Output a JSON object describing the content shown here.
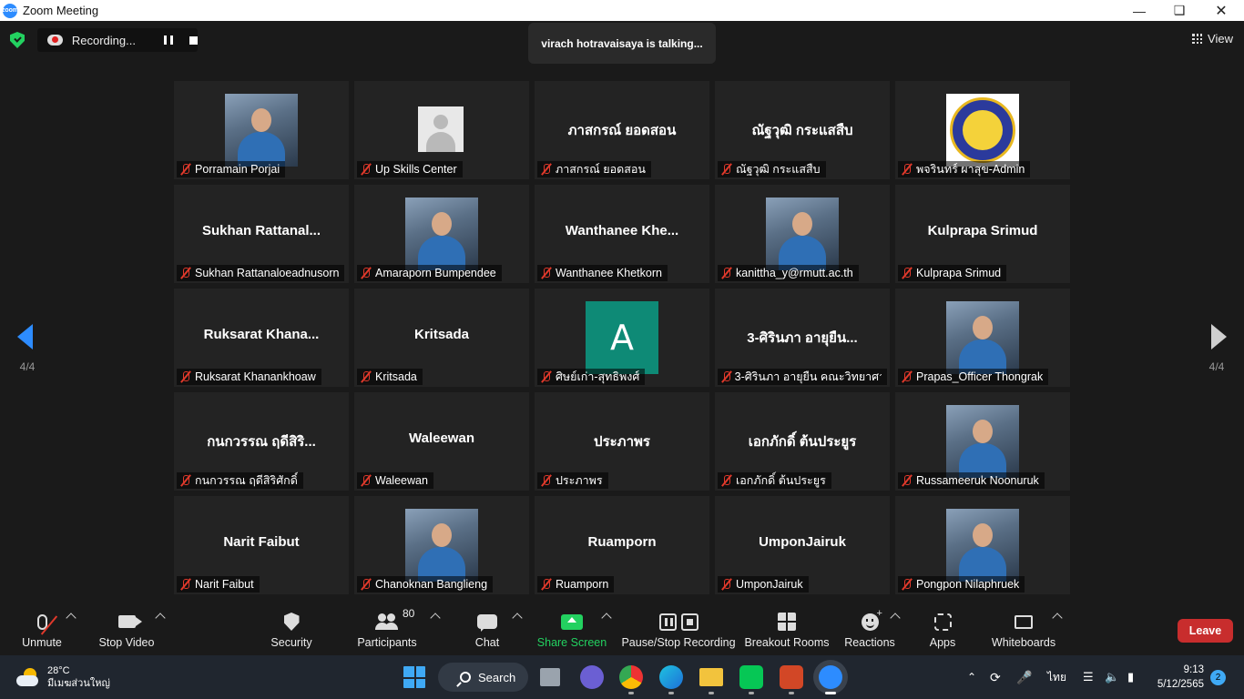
{
  "window": {
    "title": "Zoom Meeting",
    "icon": "zoom-icon"
  },
  "recording": {
    "label": "Recording..."
  },
  "talking_banner": "virach hotravaisaya is talking...",
  "view_button": "View",
  "page_indicator": {
    "left": "4/4",
    "right": "4/4"
  },
  "participants": [
    {
      "name": "Porramain Porjai",
      "display": "",
      "avatar": "photo"
    },
    {
      "name": "Up Skills Center",
      "display": "",
      "avatar": "generic"
    },
    {
      "name": "ภาสกรณ์ ยอดสอน",
      "display": "ภาสกรณ์ ยอดสอน",
      "avatar": "none"
    },
    {
      "name": "ณัฐวุฒิ กระแสสืบ",
      "display": "ณัฐวุฒิ กระแสสืบ",
      "avatar": "none"
    },
    {
      "name": "พจรินทร์ ผาสุข-Admin",
      "display": "",
      "avatar": "logo"
    },
    {
      "name": "Sukhan Rattanaloeadnusorn",
      "display": "Sukhan  Rattanal...",
      "avatar": "none"
    },
    {
      "name": "Amaraporn Bumpendee",
      "display": "",
      "avatar": "photo"
    },
    {
      "name": "Wanthanee Khetkorn",
      "display": "Wanthanee  Khe...",
      "avatar": "none"
    },
    {
      "name": "kanittha_y@rmutt.ac.th",
      "display": "",
      "avatar": "photo"
    },
    {
      "name": "Kulprapa Srimud",
      "display": "Kulprapa Srimud",
      "avatar": "none"
    },
    {
      "name": "Ruksarat Khanankhoaw",
      "display": "Ruksarat  Khana...",
      "avatar": "none"
    },
    {
      "name": "Kritsada",
      "display": "Kritsada",
      "avatar": "none"
    },
    {
      "name": "ศิษย์เก่า-สุทธิพงศ์",
      "display": "",
      "avatar": "letter",
      "letter": "A"
    },
    {
      "name": "3-ศิรินภา อายุยืน คณะวิทยาศา...",
      "display": "3-ศิรินภา อายุยืน...",
      "avatar": "none"
    },
    {
      "name": "Prapas_Officer Thongrak",
      "display": "",
      "avatar": "photo"
    },
    {
      "name": "กนกวรรณ ฤดีสิริศักดิ์",
      "display": "กนกวรรณ ฤดีสิริ...",
      "avatar": "none"
    },
    {
      "name": "Waleewan",
      "display": "Waleewan",
      "avatar": "none"
    },
    {
      "name": "ประภาพร",
      "display": "ประภาพร",
      "avatar": "none"
    },
    {
      "name": "เอกภักดิ์ ต้นประยูร",
      "display": "เอกภักดิ์ ต้นประยูร",
      "avatar": "none"
    },
    {
      "name": "Russameeruk Noonuruk",
      "display": "",
      "avatar": "photo"
    },
    {
      "name": "Narit Faibut",
      "display": "Narit Faibut",
      "avatar": "none"
    },
    {
      "name": "Chanoknan Banglieng",
      "display": "",
      "avatar": "photo"
    },
    {
      "name": "Ruamporn",
      "display": "Ruamporn",
      "avatar": "none"
    },
    {
      "name": "UmponJairuk",
      "display": "UmponJairuk",
      "avatar": "none"
    },
    {
      "name": "Pongpon Nilaphruek",
      "display": "",
      "avatar": "photo"
    }
  ],
  "toolbar": {
    "unmute": "Unmute",
    "stop_video": "Stop Video",
    "security": "Security",
    "participants": "Participants",
    "participants_count": "80",
    "chat": "Chat",
    "share_screen": "Share Screen",
    "pause_stop_recording": "Pause/Stop Recording",
    "breakout_rooms": "Breakout Rooms",
    "reactions": "Reactions",
    "apps": "Apps",
    "whiteboards": "Whiteboards",
    "leave": "Leave"
  },
  "colors": {
    "share_green": "#23d160",
    "leave_red": "#c82d2d",
    "mic_red": "#e0392b",
    "nav_blue": "#2d8cff"
  },
  "taskbar": {
    "weather_temp": "28°C",
    "weather_desc": "มีเมฆส่วนใหญ่",
    "search": "Search",
    "language": "ไทย",
    "time": "9:13",
    "date": "5/12/2565",
    "notifications": "2"
  }
}
